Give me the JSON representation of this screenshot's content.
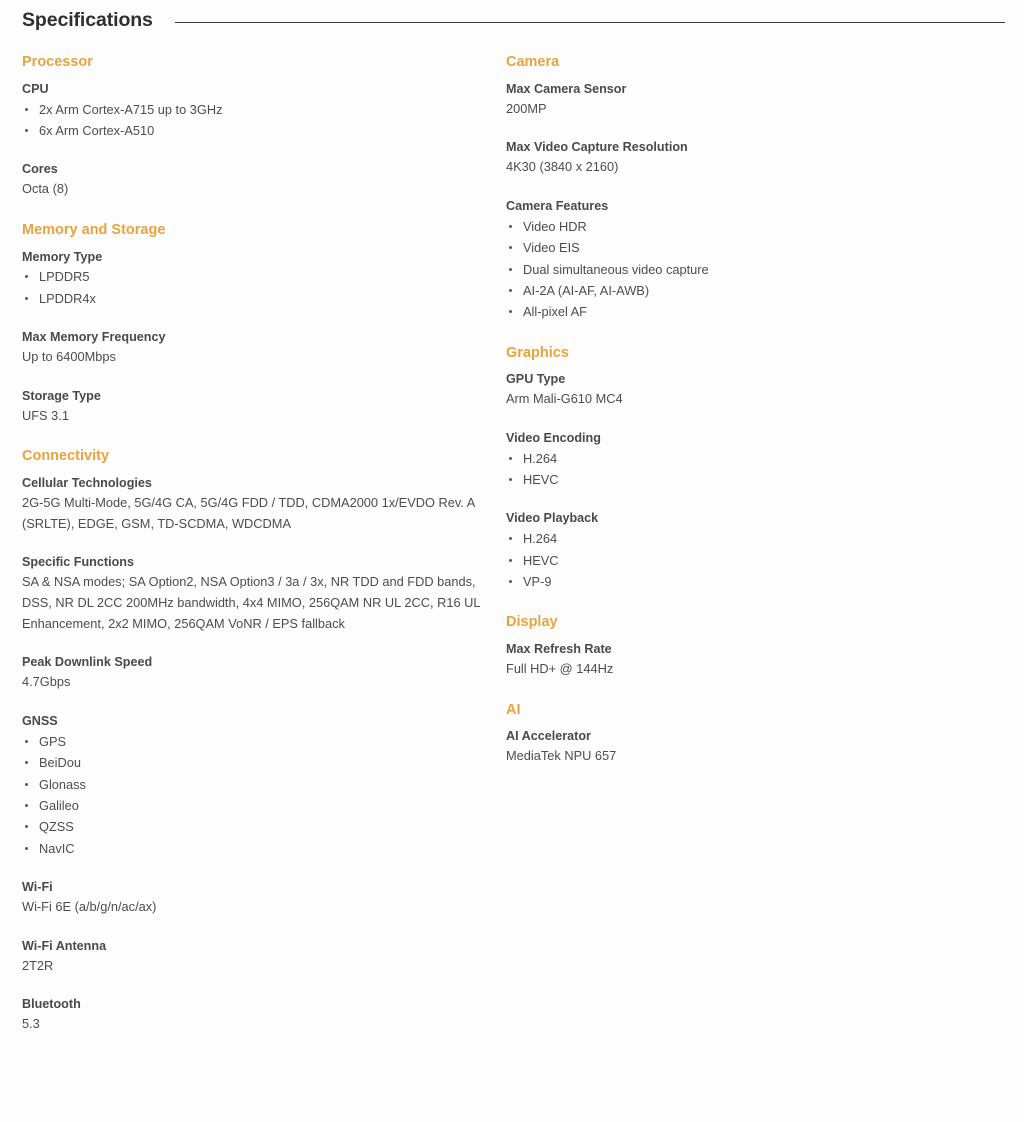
{
  "header": {
    "title": "Specifications"
  },
  "left_column": [
    {
      "section": "Processor",
      "specs": [
        {
          "label": "CPU",
          "type": "list",
          "items": [
            "2x Arm Cortex-A715 up to 3GHz",
            "6x Arm Cortex-A510"
          ]
        },
        {
          "label": "Cores",
          "type": "text",
          "value": "Octa (8)"
        }
      ]
    },
    {
      "section": "Memory and Storage",
      "specs": [
        {
          "label": "Memory Type",
          "type": "list",
          "items": [
            "LPDDR5",
            "LPDDR4x"
          ]
        },
        {
          "label": "Max Memory Frequency",
          "type": "text",
          "value": "Up to 6400Mbps"
        },
        {
          "label": "Storage Type",
          "type": "text",
          "value": "UFS 3.1"
        }
      ]
    },
    {
      "section": "Connectivity",
      "specs": [
        {
          "label": "Cellular Technologies",
          "type": "text",
          "value": "2G-5G Multi-Mode, 5G/4G CA, 5G/4G FDD / TDD, CDMA2000 1x/EVDO Rev. A (SRLTE), EDGE, GSM, TD-SCDMA, WDCDMA"
        },
        {
          "label": "Specific Functions",
          "type": "text",
          "value": "SA & NSA modes; SA Option2, NSA Option3 / 3a / 3x, NR TDD and FDD bands, DSS, NR DL 2CC 200MHz bandwidth, 4x4 MIMO, 256QAM NR UL 2CC, R16 UL Enhancement, 2x2 MIMO, 256QAM VoNR / EPS fallback"
        },
        {
          "label": "Peak Downlink Speed",
          "type": "text",
          "value": "4.7Gbps"
        },
        {
          "label": "GNSS",
          "type": "list",
          "items": [
            "GPS",
            "BeiDou",
            "Glonass",
            "Galileo",
            "QZSS",
            "NavIC"
          ]
        },
        {
          "label": "Wi-Fi",
          "type": "text",
          "value": "Wi-Fi 6E (a/b/g/n/ac/ax)"
        },
        {
          "label": "Wi-Fi Antenna",
          "type": "text",
          "value": "2T2R"
        },
        {
          "label": "Bluetooth",
          "type": "text",
          "value": "5.3"
        }
      ]
    }
  ],
  "right_column": [
    {
      "section": "Camera",
      "specs": [
        {
          "label": "Max Camera Sensor",
          "type": "text",
          "value": "200MP"
        },
        {
          "label": "Max Video Capture Resolution",
          "type": "text",
          "value": "4K30 (3840 x 2160)"
        },
        {
          "label": "Camera Features",
          "type": "list",
          "items": [
            "Video HDR",
            "Video EIS",
            "Dual simultaneous video capture",
            "AI-2A (AI-AF, AI-AWB)",
            "All-pixel AF"
          ]
        }
      ]
    },
    {
      "section": "Graphics",
      "specs": [
        {
          "label": "GPU Type",
          "type": "text",
          "value": "Arm Mali-G610 MC4"
        },
        {
          "label": "Video Encoding",
          "type": "list",
          "items": [
            "H.264",
            "HEVC"
          ]
        },
        {
          "label": "Video Playback",
          "type": "list",
          "items": [
            "H.264",
            "HEVC",
            "VP-9"
          ]
        }
      ]
    },
    {
      "section": "Display",
      "specs": [
        {
          "label": "Max Refresh Rate",
          "type": "text",
          "value": "Full HD+ @ 144Hz"
        }
      ]
    },
    {
      "section": "AI",
      "specs": [
        {
          "label": "AI Accelerator",
          "type": "text",
          "value": "MediaTek NPU 657"
        }
      ]
    }
  ],
  "colors": {
    "accent": "#e8a33d",
    "text": "#4d4d4d",
    "title": "#2f2f2f",
    "rule": "#3c3c3c",
    "background": "#fdfdfd"
  }
}
